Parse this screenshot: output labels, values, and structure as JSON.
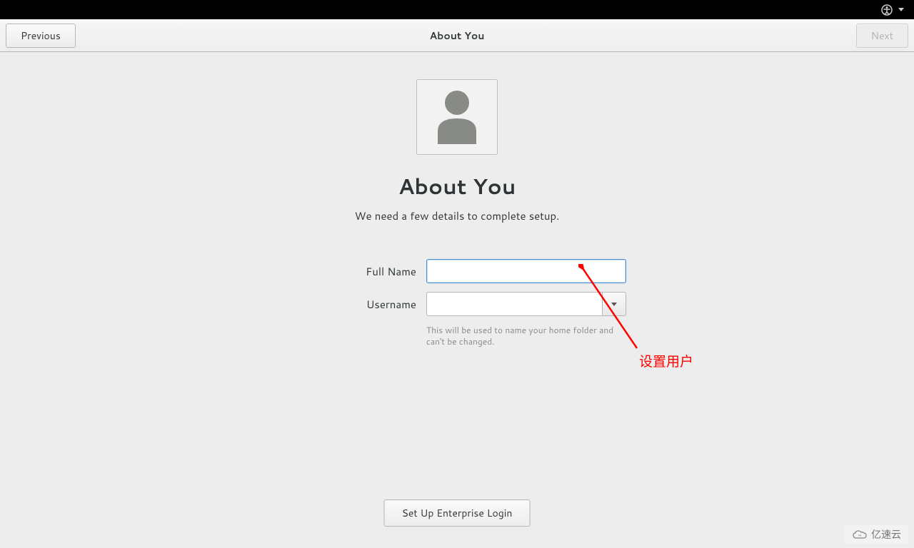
{
  "header": {
    "title": "About You",
    "previous": "Previous",
    "next": "Next"
  },
  "main": {
    "heading": "About You",
    "subtitle": "We need a few details to complete setup.",
    "full_name_label": "Full Name",
    "full_name_value": "",
    "username_label": "Username",
    "username_value": "",
    "username_hint": "This will be used to name your home folder and can't be changed.",
    "enterprise_button": "Set Up Enterprise Login"
  },
  "annotation": {
    "text": "设置用户"
  },
  "watermark": {
    "text": "亿速云"
  }
}
